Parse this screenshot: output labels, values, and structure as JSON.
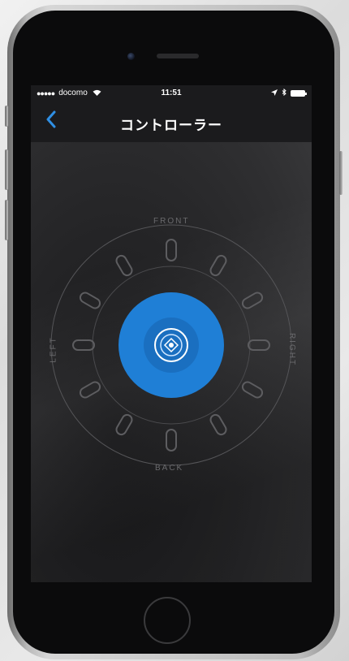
{
  "status": {
    "signal_dots": "●●●●●",
    "carrier": "docomo",
    "time": "11:51"
  },
  "nav": {
    "back_icon": "chevron-left-icon",
    "title": "コントローラー"
  },
  "controller": {
    "labels": {
      "front": "FRONT",
      "back": "BACK",
      "left": "LEFT",
      "right": "RIGHT"
    },
    "accent_color": "#1f7fd6"
  }
}
